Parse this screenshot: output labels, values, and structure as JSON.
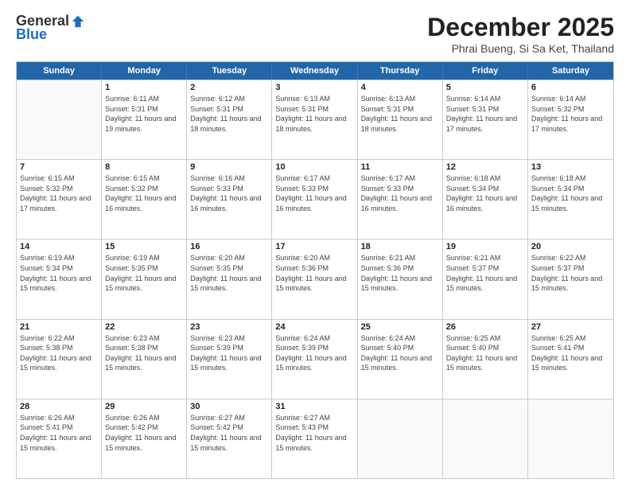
{
  "logo": {
    "general": "General",
    "blue": "Blue"
  },
  "header": {
    "month": "December 2025",
    "location": "Phrai Bueng, Si Sa Ket, Thailand"
  },
  "days": [
    "Sunday",
    "Monday",
    "Tuesday",
    "Wednesday",
    "Thursday",
    "Friday",
    "Saturday"
  ],
  "weeks": [
    [
      {
        "day": "",
        "sunrise": "",
        "sunset": "",
        "daylight": ""
      },
      {
        "day": "1",
        "sunrise": "Sunrise: 6:11 AM",
        "sunset": "Sunset: 5:31 PM",
        "daylight": "Daylight: 11 hours and 19 minutes."
      },
      {
        "day": "2",
        "sunrise": "Sunrise: 6:12 AM",
        "sunset": "Sunset: 5:31 PM",
        "daylight": "Daylight: 11 hours and 18 minutes."
      },
      {
        "day": "3",
        "sunrise": "Sunrise: 6:13 AM",
        "sunset": "Sunset: 5:31 PM",
        "daylight": "Daylight: 11 hours and 18 minutes."
      },
      {
        "day": "4",
        "sunrise": "Sunrise: 6:13 AM",
        "sunset": "Sunset: 5:31 PM",
        "daylight": "Daylight: 11 hours and 18 minutes."
      },
      {
        "day": "5",
        "sunrise": "Sunrise: 6:14 AM",
        "sunset": "Sunset: 5:31 PM",
        "daylight": "Daylight: 11 hours and 17 minutes."
      },
      {
        "day": "6",
        "sunrise": "Sunrise: 6:14 AM",
        "sunset": "Sunset: 5:32 PM",
        "daylight": "Daylight: 11 hours and 17 minutes."
      }
    ],
    [
      {
        "day": "7",
        "sunrise": "Sunrise: 6:15 AM",
        "sunset": "Sunset: 5:32 PM",
        "daylight": "Daylight: 11 hours and 17 minutes."
      },
      {
        "day": "8",
        "sunrise": "Sunrise: 6:15 AM",
        "sunset": "Sunset: 5:32 PM",
        "daylight": "Daylight: 11 hours and 16 minutes."
      },
      {
        "day": "9",
        "sunrise": "Sunrise: 6:16 AM",
        "sunset": "Sunset: 5:33 PM",
        "daylight": "Daylight: 11 hours and 16 minutes."
      },
      {
        "day": "10",
        "sunrise": "Sunrise: 6:17 AM",
        "sunset": "Sunset: 5:33 PM",
        "daylight": "Daylight: 11 hours and 16 minutes."
      },
      {
        "day": "11",
        "sunrise": "Sunrise: 6:17 AM",
        "sunset": "Sunset: 5:33 PM",
        "daylight": "Daylight: 11 hours and 16 minutes."
      },
      {
        "day": "12",
        "sunrise": "Sunrise: 6:18 AM",
        "sunset": "Sunset: 5:34 PM",
        "daylight": "Daylight: 11 hours and 16 minutes."
      },
      {
        "day": "13",
        "sunrise": "Sunrise: 6:18 AM",
        "sunset": "Sunset: 5:34 PM",
        "daylight": "Daylight: 11 hours and 15 minutes."
      }
    ],
    [
      {
        "day": "14",
        "sunrise": "Sunrise: 6:19 AM",
        "sunset": "Sunset: 5:34 PM",
        "daylight": "Daylight: 11 hours and 15 minutes."
      },
      {
        "day": "15",
        "sunrise": "Sunrise: 6:19 AM",
        "sunset": "Sunset: 5:35 PM",
        "daylight": "Daylight: 11 hours and 15 minutes."
      },
      {
        "day": "16",
        "sunrise": "Sunrise: 6:20 AM",
        "sunset": "Sunset: 5:35 PM",
        "daylight": "Daylight: 11 hours and 15 minutes."
      },
      {
        "day": "17",
        "sunrise": "Sunrise: 6:20 AM",
        "sunset": "Sunset: 5:36 PM",
        "daylight": "Daylight: 11 hours and 15 minutes."
      },
      {
        "day": "18",
        "sunrise": "Sunrise: 6:21 AM",
        "sunset": "Sunset: 5:36 PM",
        "daylight": "Daylight: 11 hours and 15 minutes."
      },
      {
        "day": "19",
        "sunrise": "Sunrise: 6:21 AM",
        "sunset": "Sunset: 5:37 PM",
        "daylight": "Daylight: 11 hours and 15 minutes."
      },
      {
        "day": "20",
        "sunrise": "Sunrise: 6:22 AM",
        "sunset": "Sunset: 5:37 PM",
        "daylight": "Daylight: 11 hours and 15 minutes."
      }
    ],
    [
      {
        "day": "21",
        "sunrise": "Sunrise: 6:22 AM",
        "sunset": "Sunset: 5:38 PM",
        "daylight": "Daylight: 11 hours and 15 minutes."
      },
      {
        "day": "22",
        "sunrise": "Sunrise: 6:23 AM",
        "sunset": "Sunset: 5:38 PM",
        "daylight": "Daylight: 11 hours and 15 minutes."
      },
      {
        "day": "23",
        "sunrise": "Sunrise: 6:23 AM",
        "sunset": "Sunset: 5:39 PM",
        "daylight": "Daylight: 11 hours and 15 minutes."
      },
      {
        "day": "24",
        "sunrise": "Sunrise: 6:24 AM",
        "sunset": "Sunset: 5:39 PM",
        "daylight": "Daylight: 11 hours and 15 minutes."
      },
      {
        "day": "25",
        "sunrise": "Sunrise: 6:24 AM",
        "sunset": "Sunset: 5:40 PM",
        "daylight": "Daylight: 11 hours and 15 minutes."
      },
      {
        "day": "26",
        "sunrise": "Sunrise: 6:25 AM",
        "sunset": "Sunset: 5:40 PM",
        "daylight": "Daylight: 11 hours and 15 minutes."
      },
      {
        "day": "27",
        "sunrise": "Sunrise: 6:25 AM",
        "sunset": "Sunset: 5:41 PM",
        "daylight": "Daylight: 11 hours and 15 minutes."
      }
    ],
    [
      {
        "day": "28",
        "sunrise": "Sunrise: 6:26 AM",
        "sunset": "Sunset: 5:41 PM",
        "daylight": "Daylight: 11 hours and 15 minutes."
      },
      {
        "day": "29",
        "sunrise": "Sunrise: 6:26 AM",
        "sunset": "Sunset: 5:42 PM",
        "daylight": "Daylight: 11 hours and 15 minutes."
      },
      {
        "day": "30",
        "sunrise": "Sunrise: 6:27 AM",
        "sunset": "Sunset: 5:42 PM",
        "daylight": "Daylight: 11 hours and 15 minutes."
      },
      {
        "day": "31",
        "sunrise": "Sunrise: 6:27 AM",
        "sunset": "Sunset: 5:43 PM",
        "daylight": "Daylight: 11 hours and 15 minutes."
      },
      {
        "day": "",
        "sunrise": "",
        "sunset": "",
        "daylight": ""
      },
      {
        "day": "",
        "sunrise": "",
        "sunset": "",
        "daylight": ""
      },
      {
        "day": "",
        "sunrise": "",
        "sunset": "",
        "daylight": ""
      }
    ]
  ]
}
